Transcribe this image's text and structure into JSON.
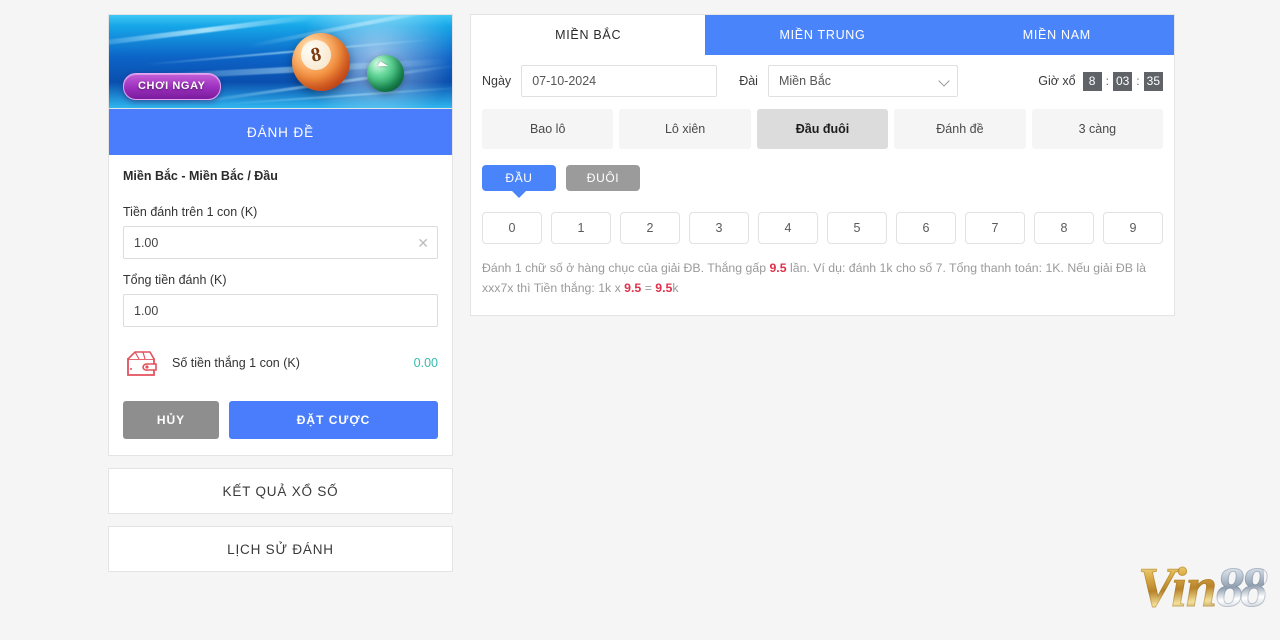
{
  "banner": {
    "cta_label": "CHƠI NGAY",
    "ball_number": "8"
  },
  "bet_card": {
    "header_title": "ĐÁNH ĐỀ",
    "bet_title": "Miền Bắc - Miền Bắc / Đầu",
    "amount_label": "Tiền đánh trên 1 con (K)",
    "amount_value": "1.00",
    "amount_placeholder": "0.00",
    "clear_icon": "close-icon",
    "total_label": "Tổng tiền đánh (K)",
    "total_value": "1.00",
    "total_placeholder": "0.00",
    "win_icon": "wallet-icon",
    "win_label": "Số tiền thắng 1 con (K)",
    "win_value": "0.00",
    "win_value_color": "#38b9b0",
    "cancel_label": "HỦY",
    "submit_label": "ĐẶT CƯỢC",
    "accent_color": "#4a7dfc"
  },
  "sidebar_buttons": [
    {
      "label": "KẾT QUẢ XỔ SỐ",
      "name": "lottery-results-button"
    },
    {
      "label": "LỊCH SỬ ĐÁNH",
      "name": "bet-history-button"
    }
  ],
  "panel": {
    "region_tabs": [
      {
        "label": "MIỀN BẮC",
        "active": true
      },
      {
        "label": "MIỀN TRUNG",
        "active": false
      },
      {
        "label": "MIỀN NAM",
        "active": false
      }
    ],
    "date_label": "Ngày",
    "date_value": "07-10-2024",
    "date_placeholder": "dd-mm-yyyy",
    "station_label": "Đài",
    "station_value": "Miền Bắc",
    "station_options": [
      "Miền Bắc"
    ],
    "chevron_icon": "chevron-down-icon",
    "countdown_label": "Giờ xổ",
    "countdown": {
      "hours": "8",
      "minutes": "03",
      "seconds": "35",
      "separator": ":"
    },
    "type_tabs": [
      {
        "label": "Bao lô",
        "active": false
      },
      {
        "label": "Lô xiên",
        "active": false
      },
      {
        "label": "Đầu đuôi",
        "active": true
      },
      {
        "label": "Đánh đề",
        "active": false
      },
      {
        "label": "3 càng",
        "active": false
      }
    ],
    "sub_tabs": [
      {
        "label": "ĐẦU",
        "active": true
      },
      {
        "label": "ĐUÔI",
        "active": false
      }
    ],
    "numbers": [
      "0",
      "1",
      "2",
      "3",
      "4",
      "5",
      "6",
      "7",
      "8",
      "9"
    ],
    "description": {
      "part1": "Đánh 1 chữ số ở hàng chục của giải ĐB. Thắng gấp ",
      "rate1": "9.5",
      "part2": " lần. Ví dụ: đánh 1k cho số 7. Tổng thanh toán: 1K. Nếu giải ĐB là xxx7x thì Tiền thắng: 1k x ",
      "rate2": "9.5",
      "part3": " = ",
      "rate3": "9.5",
      "part4": "k",
      "highlight_color": "#e0304a"
    }
  },
  "logo": {
    "text_gold": "Vin",
    "text_silver": "88"
  }
}
